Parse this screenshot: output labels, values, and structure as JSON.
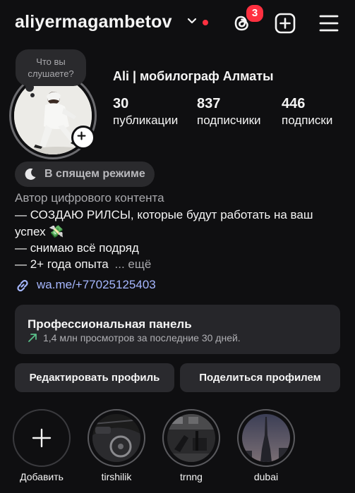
{
  "header": {
    "username": "aliyermagambetov",
    "threads_badge_count": "3",
    "icons": [
      "chevron-down-icon",
      "threads-icon",
      "add-post-icon",
      "menu-icon"
    ]
  },
  "profile": {
    "note_text": "Что вы слушаете?",
    "full_name": "Ali | мобилограф Алматы",
    "stats": [
      {
        "value": "30",
        "label": "публикации"
      },
      {
        "value": "837",
        "label": "подписчики"
      },
      {
        "value": "446",
        "label": "подписки"
      }
    ],
    "sleep_mode_label": "В спящем режиме",
    "category": "Автор цифрового контента",
    "bio_lines": [
      "— СОЗДАЮ РИЛСЫ, которые будут работать на ваш",
      "успех 💸",
      "— снимаю всё подряд",
      "— 2+ года опыта"
    ],
    "more_label": "... ещё",
    "link": "wa.me/+77025125403"
  },
  "professional_panel": {
    "title": "Профессиональная панель",
    "subtitle": "1,4 млн просмотров за последние 30 дней."
  },
  "buttons": {
    "edit_profile": "Редактировать профиль",
    "share_profile": "Поделиться профилем"
  },
  "highlights": [
    {
      "label": "Добавить"
    },
    {
      "label": "tirshilik"
    },
    {
      "label": "trnng"
    },
    {
      "label": "dubai"
    }
  ],
  "colors": {
    "background": "#0f0f11",
    "accent_red": "#ff3040",
    "link_blue": "#a6b7ff",
    "growth_green": "#5ac08a"
  }
}
